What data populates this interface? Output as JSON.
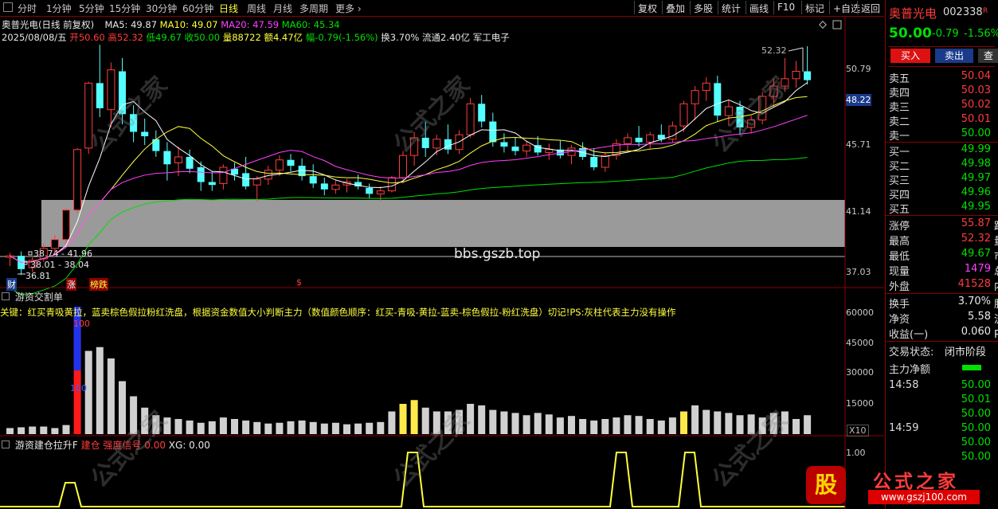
{
  "toolbar": {
    "periods": [
      "分时",
      "1分钟",
      "5分钟",
      "15分钟",
      "30分钟",
      "60分钟",
      "日线",
      "周线",
      "月线",
      "多周期",
      "更多"
    ],
    "active_period": "日线",
    "buttons": [
      "复权",
      "叠加",
      "多股",
      "统计",
      "画线",
      "F10",
      "标记",
      "+自选",
      "返回"
    ]
  },
  "stock": {
    "name": "奥普光电",
    "code": "002338",
    "rzrq": "R",
    "price": "50.00",
    "change": "-0.79",
    "change_pct": "-1.56%"
  },
  "header": {
    "title": "奥普光电(日线 前复权)",
    "ma5": "MA5: 49.87",
    "ma10": "MA10: 49.07",
    "ma20": "MA20: 47.59",
    "ma60": "MA60: 45.34",
    "date": "2025/08/08/五",
    "open": "开50.60",
    "high": "高52.32",
    "low": "低49.67",
    "close": "收50.00",
    "volume": "量88722",
    "amount": "额4.47亿",
    "amp": "幅-0.79(-1.56%)",
    "turnover": "换3.70%",
    "float": "流通2.40亿",
    "sector": "军工电子"
  },
  "price_axis": [
    "50.79",
    "48.22",
    "45.71",
    "41.14",
    "37.03"
  ],
  "annotations": {
    "high_mark": "52.32",
    "box1": "38.74 - 41.96",
    "box2": "38.01 - 38.04",
    "low_mark": "36.81",
    "tags": [
      "财",
      "涨",
      "榜跌",
      "$"
    ],
    "site": "bbs.gszb.top"
  },
  "panel2": {
    "title": "游资交割单",
    "desc": "关键：红买青吸黄拉，蓝卖棕色假拉粉红洗盘，根据资金数值大小判断主力（数值颜色顺序：红买-青吸-黄拉-蓝卖-棕色假拉-粉红洗盘）切记!PS:灰柱代表主力没有操作",
    "axis": [
      "60000",
      "45000",
      "30000",
      "15000"
    ],
    "label_100a": "100",
    "label_100b": "100",
    "x10": "X10"
  },
  "panel3": {
    "title": "游资建仓拉升F",
    "signal": "建仓",
    "signal2": "强度信号",
    "val": "0.00",
    "xg": "XG: 0.00",
    "axis": "1.00"
  },
  "orderbook": {
    "sell": [
      {
        "label": "卖五",
        "val": "50.04"
      },
      {
        "label": "卖四",
        "val": "50.03"
      },
      {
        "label": "卖三",
        "val": "50.02"
      },
      {
        "label": "卖二",
        "val": "50.01"
      },
      {
        "label": "卖一",
        "val": "50.00"
      }
    ],
    "buy": [
      {
        "label": "买一",
        "val": "49.99"
      },
      {
        "label": "买二",
        "val": "49.98"
      },
      {
        "label": "买三",
        "val": "49.97"
      },
      {
        "label": "买四",
        "val": "49.96"
      },
      {
        "label": "买五",
        "val": "49.95"
      }
    ]
  },
  "quote": [
    {
      "label": "涨停",
      "val": "55.87",
      "extra": "跌停"
    },
    {
      "label": "最高",
      "val": "52.32",
      "extra": "量比"
    },
    {
      "label": "最低",
      "val": "49.67",
      "extra": "市值"
    },
    {
      "label": "现量",
      "val": "1479",
      "extra": "总量"
    },
    {
      "label": "外盘",
      "val": "41528",
      "extra": "内盘"
    }
  ],
  "stats": [
    {
      "label": "换手",
      "val": "3.70%",
      "extra": "股本"
    },
    {
      "label": "净资",
      "val": "5.58",
      "extra": "流通"
    },
    {
      "label": "收益(一)",
      "val": "0.060",
      "extra": "PE(动)"
    }
  ],
  "trade_state": {
    "label": "交易状态:",
    "val": "闭市阶段"
  },
  "main_net": "主力净额",
  "ticks": [
    {
      "time": "14:58",
      "vals": [
        "50.00",
        "50.01",
        "50.00"
      ]
    },
    {
      "time": "14:59",
      "vals": [
        "50.00",
        "50.00",
        "50.00"
      ]
    }
  ],
  "buttons": {
    "buy": "买入",
    "sell": "卖出",
    "other": "查"
  },
  "brand": {
    "text": "公式之家",
    "url": "www.gszj100.com",
    "badge": "股"
  },
  "price_tag": "48.22",
  "colors": {
    "up": "#ff3c3c",
    "down": "#54ffff",
    "ma5": "#ffffff",
    "ma10": "#ffff3c",
    "ma20": "#ff40ff",
    "ma60": "#00e000",
    "bg": "#000000",
    "border": "#8b0000"
  }
}
